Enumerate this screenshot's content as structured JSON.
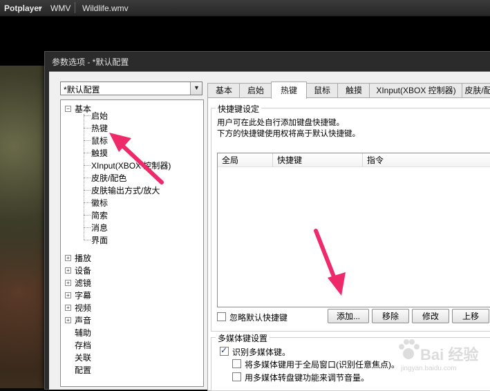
{
  "topbar": {
    "brand": "Potplayer",
    "format": "WMV",
    "filename": "Wildlife.wmv"
  },
  "dialog": {
    "title": "参数选项 - *默认配置",
    "preset": "*默认配置"
  },
  "tree": {
    "basic": {
      "label": "基本",
      "children": [
        "启始",
        "热键",
        "鼠标",
        "触摸",
        "XInput(XBOX 控制器)",
        "皮肤/配色",
        "皮肤输出方式/放大",
        "徽标",
        "简索",
        "消息",
        "界面"
      ]
    },
    "groups": [
      "播放",
      "设备",
      "滤镜",
      "字幕",
      "视频",
      "声音"
    ],
    "leaves": [
      "辅助",
      "存档",
      "关联",
      "配置"
    ]
  },
  "tabs": [
    "基本",
    "启始",
    "热键",
    "鼠标",
    "触摸",
    "XInput(XBOX 控制器)",
    "皮肤/配"
  ],
  "active_tab": "热键",
  "hotkey_group": {
    "title": "快捷键设定",
    "line1": "用户可在此处自行添加键盘快捷键。",
    "line2": "下方的快捷键使用权将高于默认快捷键。",
    "columns": [
      "全局",
      "快捷键",
      "指令"
    ],
    "ignore_default_label": "忽略默认快捷键",
    "ignore_default_checked": false,
    "buttons": {
      "add": "添加...",
      "remove": "移除",
      "modify": "修改",
      "up": "上移"
    }
  },
  "media_group": {
    "title": "多媒体键设置",
    "recognize_label": "识别多媒体键。",
    "recognize_checked": true,
    "global_label": "将多媒体键用于全局窗口(识别任意焦点)。",
    "global_checked": false,
    "jog_label": "用多媒体转盘键功能来调节音量。",
    "jog_checked": false
  },
  "watermark": {
    "text": "Bai 经验",
    "sub": "jingyan.baidu.com"
  },
  "colors": {
    "annotation_arrow": "#ee2a6a",
    "titlebar": "#2b2b2b"
  }
}
